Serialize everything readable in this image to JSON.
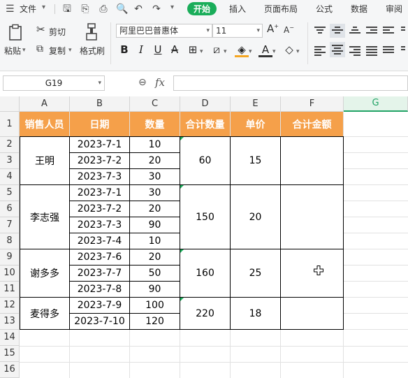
{
  "menubar": {
    "file_label": "文件",
    "tabs": [
      "开始",
      "插入",
      "页面布局",
      "公式",
      "数据",
      "审阅"
    ]
  },
  "ribbon": {
    "paste_label": "粘贴",
    "cut_label": "剪切",
    "copy_label": "复制",
    "format_painter_label": "格式刷",
    "font_name": "阿里巴巴普惠体",
    "font_size": "11"
  },
  "formula_bar": {
    "cell_ref": "G19",
    "fx_label": "fx",
    "value": ""
  },
  "sheet": {
    "columns": [
      "A",
      "B",
      "C",
      "D",
      "E",
      "F",
      "G"
    ],
    "selected_column": "G",
    "rows": [
      "1",
      "2",
      "3",
      "4",
      "5",
      "6",
      "7",
      "8",
      "9",
      "10",
      "11",
      "12",
      "13",
      "14",
      "15",
      "16"
    ],
    "header": [
      "销售人员",
      "日期",
      "数量",
      "合计数量",
      "单价",
      "合计金额"
    ],
    "groups": [
      {
        "salesperson": "王明",
        "total_qty": "60",
        "unit_price": "15",
        "amount": "",
        "rows": [
          {
            "date": "2023-7-1",
            "qty": "10"
          },
          {
            "date": "2023-7-2",
            "qty": "20"
          },
          {
            "date": "2023-7-3",
            "qty": "30"
          }
        ]
      },
      {
        "salesperson": "李志强",
        "total_qty": "150",
        "unit_price": "20",
        "amount": "",
        "rows": [
          {
            "date": "2023-7-1",
            "qty": "30"
          },
          {
            "date": "2023-7-2",
            "qty": "20"
          },
          {
            "date": "2023-7-3",
            "qty": "90"
          },
          {
            "date": "2023-7-4",
            "qty": "10"
          }
        ]
      },
      {
        "salesperson": "谢多多",
        "total_qty": "160",
        "unit_price": "25",
        "amount": "",
        "rows": [
          {
            "date": "2023-7-6",
            "qty": "20"
          },
          {
            "date": "2023-7-7",
            "qty": "50"
          },
          {
            "date": "2023-7-8",
            "qty": "90"
          }
        ]
      },
      {
        "salesperson": "麦得多",
        "total_qty": "220",
        "unit_price": "18",
        "amount": "",
        "rows": [
          {
            "date": "2023-7-9",
            "qty": "100"
          },
          {
            "date": "2023-7-10",
            "qty": "120"
          }
        ]
      }
    ]
  }
}
